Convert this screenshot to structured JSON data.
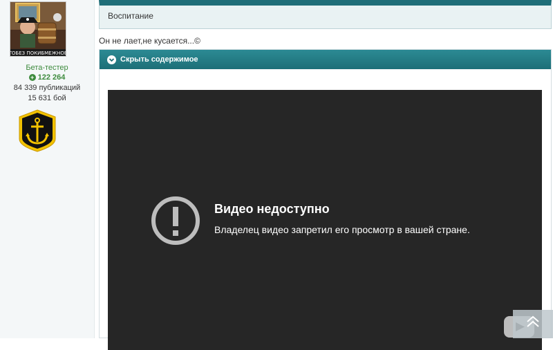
{
  "author": {
    "avatar_banner": "ТОБЕЗ ПОКИБМЕЖНОЕ",
    "group": "Бета-тестер",
    "reputation": "122 264",
    "posts": "84 339 публикаций",
    "battles": "15 631 бой"
  },
  "quote": {
    "text": "Воспитание"
  },
  "post": {
    "text": "Он не лает,не кусается...©"
  },
  "spoiler": {
    "toggle_label": "Скрыть содержимое"
  },
  "video": {
    "title": "Видео недоступно",
    "message": "Владелец видео запретил его просмотр в вашей стране."
  },
  "colors": {
    "accent": "#1f6e78",
    "reputation_green": "#3d8b3d",
    "video_bg": "#262626"
  }
}
